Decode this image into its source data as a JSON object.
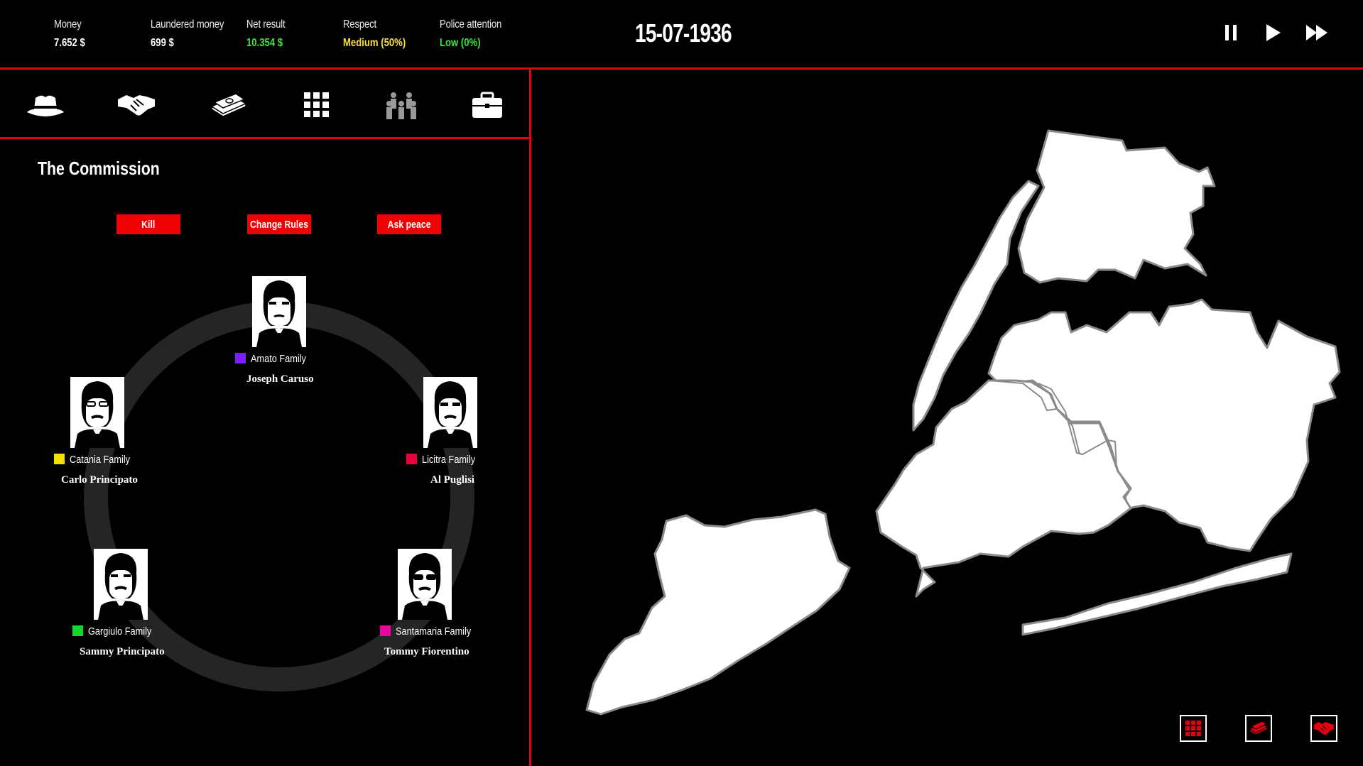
{
  "stats": [
    {
      "label": "Money",
      "value": "7.652 $",
      "color": "#ffffff"
    },
    {
      "label": "Laundered money",
      "value": "699 $",
      "color": "#ffffff"
    },
    {
      "label": "Net result",
      "value": "10.354 $",
      "color": "#39e639"
    },
    {
      "label": "Respect",
      "value": "Medium (50%)",
      "color": "#f5e13b"
    },
    {
      "label": "Police attention",
      "value": "Low (0%)",
      "color": "#39e639"
    }
  ],
  "date": "15-07-1936",
  "speed_controls": [
    "pause-icon",
    "play-icon",
    "fast-forward-icon"
  ],
  "tabs": [
    "fedora-hat-icon",
    "handshake-icon",
    "money-stack-icon",
    "grid-icon",
    "people-icon",
    "briefcase-icon"
  ],
  "panel": {
    "title": "The Commission",
    "actions": [
      "Kill",
      "Change Rules",
      "Ask peace"
    ]
  },
  "families": [
    {
      "family": "Amato Family",
      "boss": "Joseph Caruso",
      "color": "#7b1fff"
    },
    {
      "family": "Licitra Family",
      "boss": "Al Puglisi",
      "color": "#e8003d"
    },
    {
      "family": "Santamaria Family",
      "boss": "Tommy Fiorentino",
      "color": "#e8069e"
    },
    {
      "family": "Gargiulo Family",
      "boss": "Sammy Principato",
      "color": "#16d62a"
    },
    {
      "family": "Catania Family",
      "boss": "Carlo Principato",
      "color": "#f3e000"
    }
  ],
  "map_buttons": [
    "grid-icon",
    "money-stack-icon",
    "handshake-icon"
  ],
  "colors": {
    "accent": "#e3000f",
    "button": "#f00000",
    "ring": "#252525"
  }
}
